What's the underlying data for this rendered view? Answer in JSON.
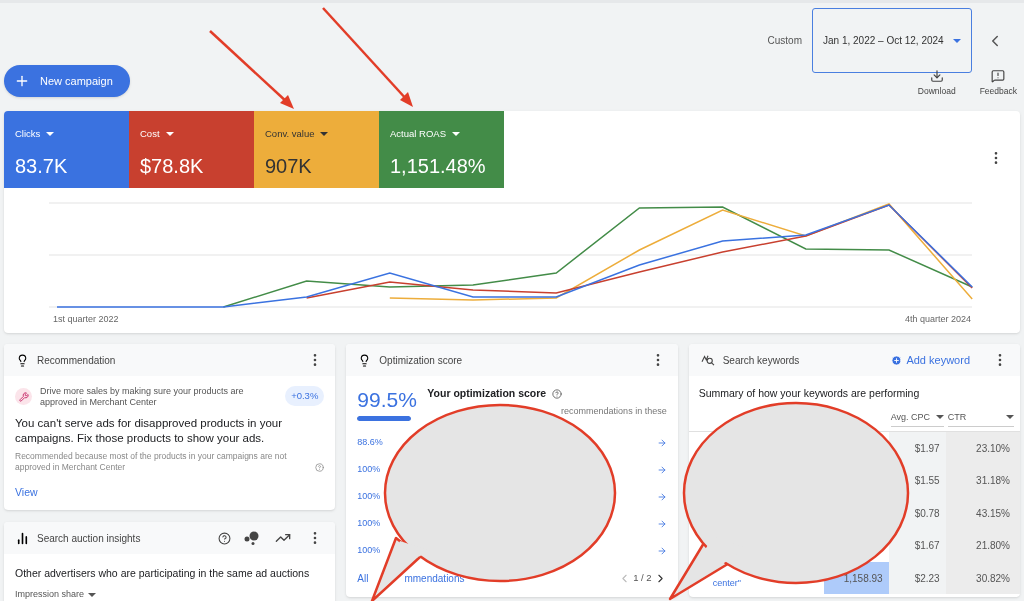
{
  "date_range": {
    "label": "Custom",
    "value": "Jan 1, 2022 – Oct 12, 2024"
  },
  "new_campaign": {
    "label": "New campaign"
  },
  "toolbar": [
    {
      "kind": "download",
      "label": "Download"
    },
    {
      "kind": "feedback",
      "label": "Feedback"
    }
  ],
  "metrics": [
    {
      "label": "Clicks",
      "value": "83.7K",
      "color": "#3a72e0"
    },
    {
      "label": "Cost",
      "value": "$78.8K",
      "color": "#c8402f"
    },
    {
      "label": "Conv. value",
      "value": "907K",
      "color": "#edad3b"
    },
    {
      "label": "Actual ROAS",
      "value": "1,151.48%",
      "color": "#438c48"
    }
  ],
  "chart": {
    "x_start": "1st quarter 2022",
    "x_end": "4th quarter 2024"
  },
  "recommendation": {
    "title": "Recommendation",
    "tip": "Drive more sales by making sure your products are approved in Merchant Center",
    "badge": "+0.3%",
    "headline": "You can't serve ads for disapproved products in your campaigns. Fix those products to show your ads.",
    "reason": "Recommended because most of the products in your campaigns are not approved in Merchant Center",
    "action": "View"
  },
  "auction": {
    "title": "Search auction insights",
    "subtitle": "Other advertisers who are participating in the same ad auctions",
    "metric": "Impression share"
  },
  "optimization": {
    "title": "Optimization score",
    "score": "99.5%",
    "level": 0.995,
    "heading": "Your optimization score",
    "text_fragment": "recommendations in these",
    "rows": [
      "88.6%",
      "100%",
      "100%",
      "100%",
      "100%"
    ],
    "link": "All",
    "link_fragment": "mmendations",
    "pager": "1 / 2"
  },
  "keywords": {
    "title": "Search keywords",
    "add": "Add keyword",
    "summary": "Summary of how your keywords are performing",
    "columns": [
      "Avg. CPC",
      "CTR"
    ],
    "rows": [
      {
        "avg_cpc": "$1.97",
        "ctr": "23.10%"
      },
      {
        "avg_cpc": "$1.55",
        "ctr": "31.18%"
      },
      {
        "avg_cpc": "$0.78",
        "ctr": "43.15%"
      },
      {
        "avg_cpc": "$1.67",
        "ctr": "21.80%"
      },
      {
        "keyword": "center\"",
        "cost": {
          "text": "1,158.93",
          "highlighted": true
        },
        "avg_cpc": "$2.23",
        "ctr": "30.82%"
      }
    ]
  }
}
